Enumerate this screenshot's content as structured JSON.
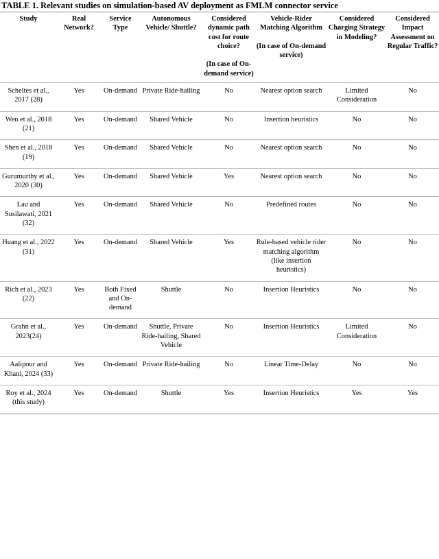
{
  "document": {
    "caption": "TABLE 1. Relevant studies on simulation-based AV deployment as FMLM connector service"
  },
  "table": {
    "headers": [
      {
        "line1": "Study",
        "line2": ""
      },
      {
        "line1": "Real Network?",
        "line2": ""
      },
      {
        "line1": "Service Type",
        "line2": ""
      },
      {
        "line1": "Autonomous Vehicle/ Shuttle?",
        "line2": ""
      },
      {
        "line1": "Considered dynamic path cost for route choice?",
        "line2": "(In case of On-demand service)"
      },
      {
        "line1": "Vehicle-Rider Matching Algorithm",
        "line2": "(In case of On-demand service)"
      },
      {
        "line1": "Considered Charging Strategy in Modeling?",
        "line2": ""
      },
      {
        "line1": "Considered Impact Assessment on Regular Traffic?",
        "line2": ""
      }
    ],
    "rows": [
      {
        "study_name": "Scheltes et al., 2017",
        "study_ref": "(28)",
        "real_network": "Yes",
        "service_type": "On-demand",
        "av_shuttle": "Private Ride-hailing",
        "dynamic_path_cost": "No",
        "matching_algorithm": "Nearest option search",
        "charging_strategy": "Limited Consideration",
        "impact_assessment": "No"
      },
      {
        "study_name": "Wen et al., 2018",
        "study_ref": "(21)",
        "real_network": "Yes",
        "service_type": "On-demand",
        "av_shuttle": "Shared Vehicle",
        "dynamic_path_cost": "No",
        "matching_algorithm": "Insertion heuristics",
        "charging_strategy": "No",
        "impact_assessment": "No"
      },
      {
        "study_name": "Shen et al., 2018",
        "study_ref": "(19)",
        "real_network": "Yes",
        "service_type": "On-demand",
        "av_shuttle": "Shared Vehicle",
        "dynamic_path_cost": "No",
        "matching_algorithm": "Nearest option search",
        "charging_strategy": "No",
        "impact_assessment": "No"
      },
      {
        "study_name": "Gurumurthy et al., 2020",
        "study_ref": "(30)",
        "real_network": "Yes",
        "service_type": "On-demand",
        "av_shuttle": "Shared Vehicle",
        "dynamic_path_cost": "Yes",
        "matching_algorithm": "Nearest option search",
        "charging_strategy": "No",
        "impact_assessment": "No"
      },
      {
        "study_name": "Lau and Susilawati, 2021",
        "study_ref": "(32)",
        "real_network": "Yes",
        "service_type": "On-demand",
        "av_shuttle": "Shared Vehicle",
        "dynamic_path_cost": "No",
        "matching_algorithm": "Predefined routes",
        "charging_strategy": "No",
        "impact_assessment": "No"
      },
      {
        "study_name": "Huang et al., 2022",
        "study_ref": "(31)",
        "real_network": "Yes",
        "service_type": "On-demand",
        "av_shuttle": "Shared Vehicle",
        "dynamic_path_cost": "Yes",
        "matching_algorithm": "Rule-based vehicle rider matching algorithm (like insertion heuristics)",
        "charging_strategy": "No",
        "impact_assessment": "No"
      },
      {
        "study_name": "Rich et al., 2023",
        "study_ref": "(22)",
        "real_network": "Yes",
        "service_type": "Both Fixed and On-demand",
        "av_shuttle": "Shuttle",
        "dynamic_path_cost": "No",
        "matching_algorithm": "Insertion Heuristics",
        "charging_strategy": "No",
        "impact_assessment": "No"
      },
      {
        "study_name": "Grahn et al., 2023",
        "study_ref": "(24)",
        "real_network": "Yes",
        "service_type": "On-demand",
        "av_shuttle": "Shuttle, Private Ride-hailing, Shared Vehicle",
        "dynamic_path_cost": "No",
        "matching_algorithm": "Insertion Heuristics",
        "charging_strategy": "Limited Consideration",
        "impact_assessment": "No"
      },
      {
        "study_name": "Aalipour and Khani, 2024",
        "study_ref": "(33)",
        "real_network": "Yes",
        "service_type": "On-demand",
        "av_shuttle": "Private Ride-hailing",
        "dynamic_path_cost": "No",
        "matching_algorithm": "Linear Time-Delay",
        "charging_strategy": "No",
        "impact_assessment": "No"
      },
      {
        "study_name": "Roy et al., 2024 (this study)",
        "study_ref": "",
        "real_network": "Yes",
        "service_type": "On-demand",
        "av_shuttle": "Shuttle",
        "dynamic_path_cost": "Yes",
        "matching_algorithm": "Insertion Heuristics",
        "charging_strategy": "Yes",
        "impact_assessment": "Yes"
      }
    ]
  }
}
